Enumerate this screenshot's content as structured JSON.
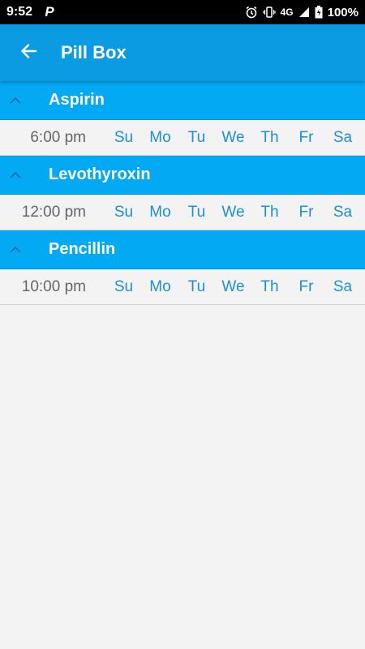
{
  "status_bar": {
    "time": "9:52",
    "network": "4G",
    "battery": "100%"
  },
  "app_bar": {
    "title": "Pill Box",
    "back_icon": "arrow-left-icon"
  },
  "medications": [
    {
      "name": "Aspirin",
      "expand_icon": "chevron-up-icon",
      "time": "6:00 pm",
      "days": [
        "Su",
        "Mo",
        "Tu",
        "We",
        "Th",
        "Fr",
        "Sa"
      ]
    },
    {
      "name": "Levothyroxin",
      "expand_icon": "chevron-up-icon",
      "time": "12:00 pm",
      "days": [
        "Su",
        "Mo",
        "Tu",
        "We",
        "Th",
        "Fr",
        "Sa"
      ]
    },
    {
      "name": "Pencillin",
      "expand_icon": "chevron-up-icon",
      "time": "10:00 pm",
      "days": [
        "Su",
        "Mo",
        "Tu",
        "We",
        "Th",
        "Fr",
        "Sa"
      ]
    }
  ],
  "colors": {
    "app_bar": "#0a9be3",
    "section_header": "#04a9f4",
    "day_text": "#1a90d6",
    "background": "#f3f3f3"
  }
}
